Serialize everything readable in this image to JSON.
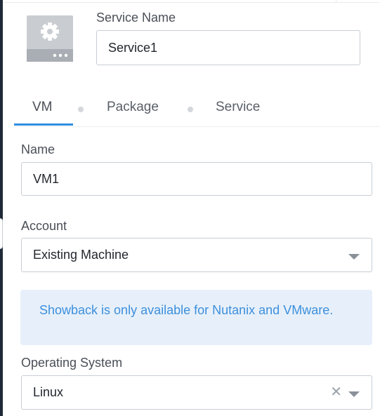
{
  "service": {
    "name_label": "Service Name",
    "name_value": "Service1",
    "icon": "gear-server-icon"
  },
  "tabs": [
    {
      "label": "VM",
      "active": true
    },
    {
      "label": "Package",
      "active": false
    },
    {
      "label": "Service",
      "active": false
    }
  ],
  "vm": {
    "name_label": "Name",
    "name_value": "VM1",
    "account_label": "Account",
    "account_value": "Existing Machine",
    "info_text": "Showback is only available for Nutanix and VMware.",
    "os_label": "Operating System",
    "os_value": "Linux"
  },
  "colors": {
    "accent": "#2f8ee0",
    "info_bg": "#e7f0fa",
    "info_text": "#3d8fdc",
    "rail": "#1f2a38"
  }
}
